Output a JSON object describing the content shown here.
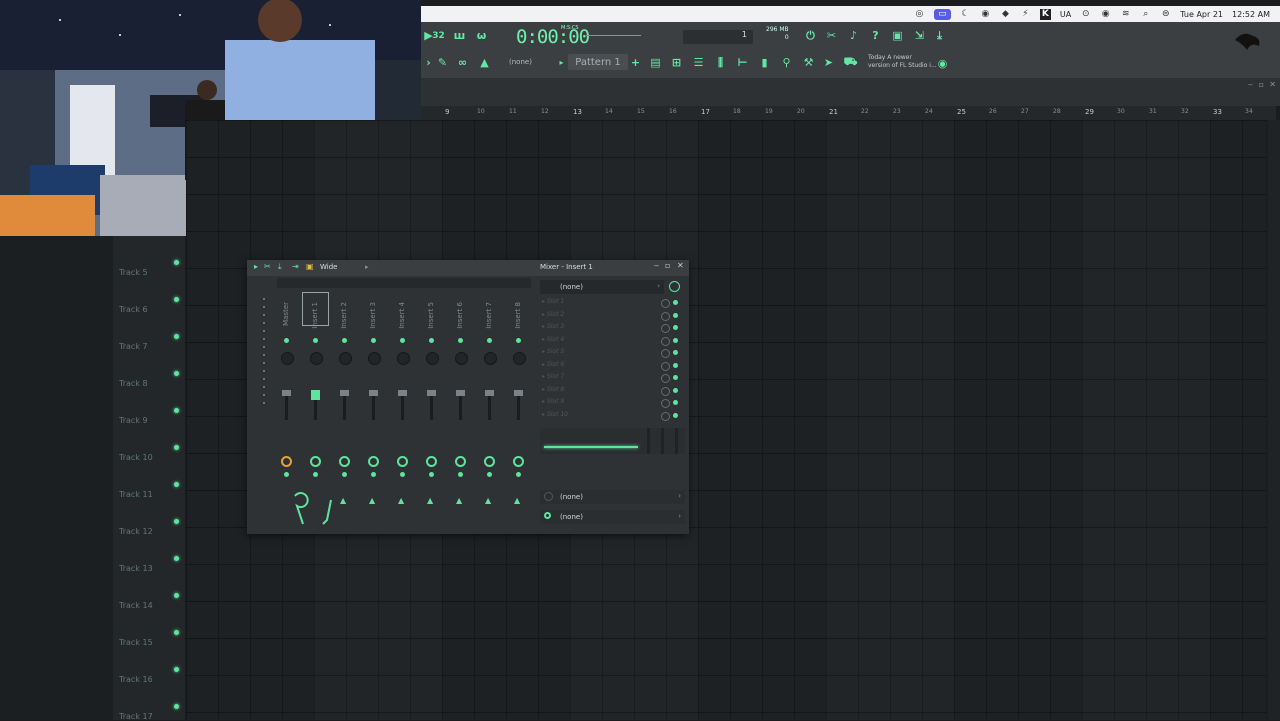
{
  "menubar": {
    "date": "Tue Apr 21",
    "time": "12:52 AM",
    "locale": "UA",
    "icons": [
      "siri-icon",
      "screen-share-icon",
      "moon-icon",
      "plugin-icon",
      "diamond-icon",
      "bolt-icon",
      "k-icon",
      "play-circle-icon",
      "record-icon",
      "wifi-icon",
      "search-icon",
      "control-center-icon"
    ]
  },
  "toolbar": {
    "time_display": "0:00:00",
    "time_unit": "M:S:CS",
    "beat_label": "32",
    "step_value": "1",
    "memory": "296 MB",
    "cpu_value": "0",
    "pattern_name": "Pattern 1",
    "pattern_none": "(none)",
    "news_line1": "Today  A newer",
    "news_line2": "version of FL Studio i..."
  },
  "ruler": {
    "bars": [
      "9",
      "10",
      "11",
      "12",
      "13",
      "14",
      "15",
      "16",
      "17",
      "18",
      "19",
      "20",
      "21",
      "22",
      "23",
      "24",
      "25",
      "26",
      "27",
      "28",
      "29",
      "30",
      "31",
      "32",
      "33",
      "34"
    ]
  },
  "tracks": [
    "Track 5",
    "Track 6",
    "Track 7",
    "Track 8",
    "Track 9",
    "Track 10",
    "Track 11",
    "Track 12",
    "Track 13",
    "Track 14",
    "Track 15",
    "Track 16",
    "Track 17"
  ],
  "mixer": {
    "preset": "Wide",
    "title": "Mixer - Insert 1",
    "strips": [
      "Master",
      "Insert 1",
      "Insert 2",
      "Insert 3",
      "Insert 4",
      "Insert 5",
      "Insert 6",
      "Insert 7",
      "Insert 8"
    ],
    "selected_strip": "Insert 1",
    "fx_chain": "(none)",
    "slots": [
      "Slot 1",
      "Slot 2",
      "Slot 3",
      "Slot 4",
      "Slot 5",
      "Slot 6",
      "Slot 7",
      "Slot 8",
      "Slot 9",
      "Slot 10"
    ],
    "input": "(none)",
    "output": "(none)"
  },
  "colors": {
    "accent": "#5fe49e",
    "toolbar_bg": "#3b3f42",
    "playlist_bg": "#1e2123",
    "menubar_bg": "#f2f2f4"
  }
}
